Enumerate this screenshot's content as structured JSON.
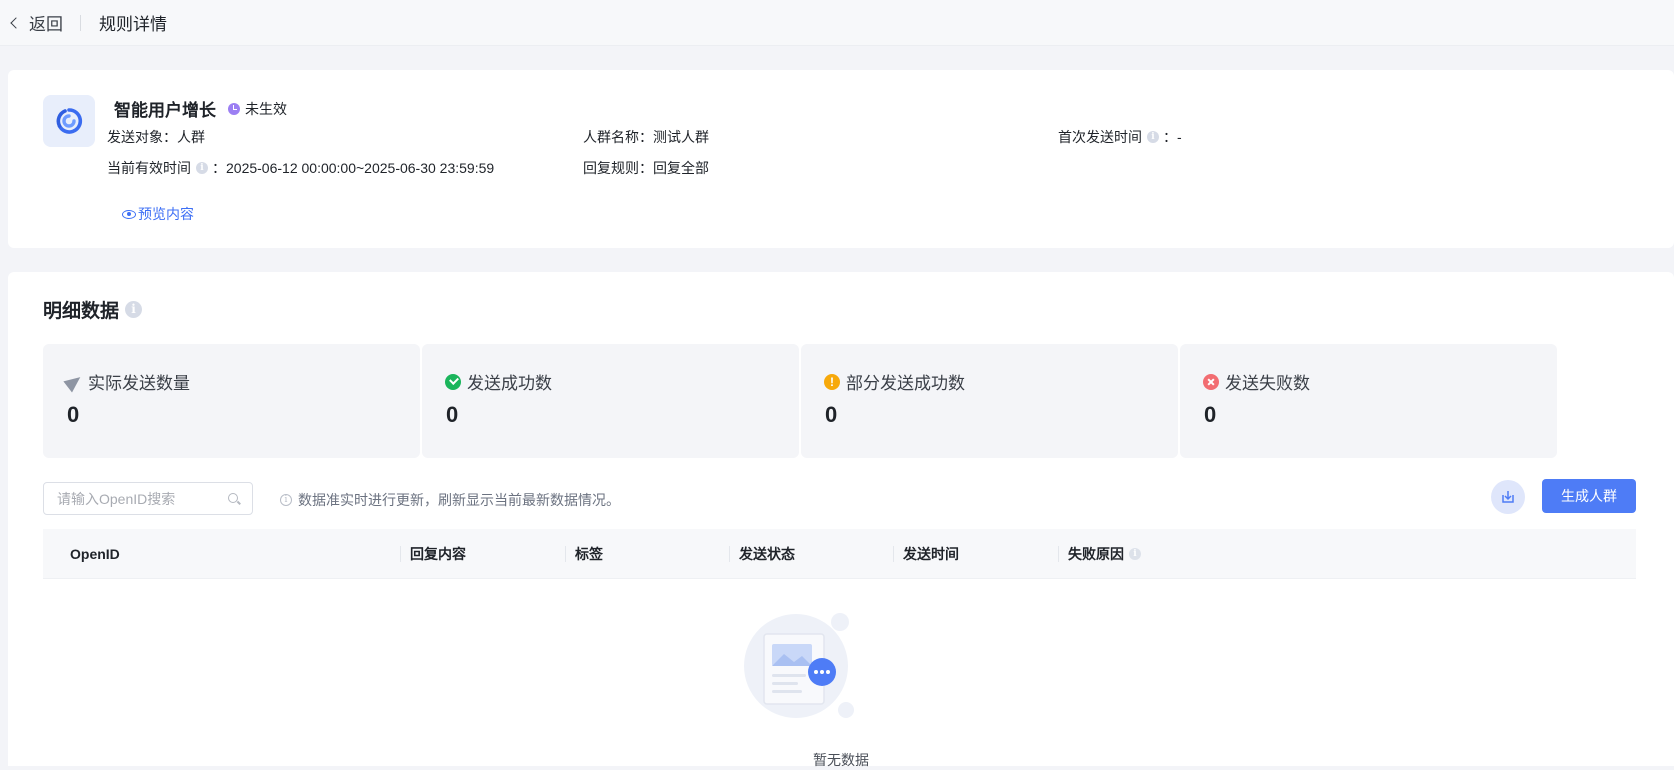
{
  "topbar": {
    "back_label": "返回",
    "page_title": "规则详情"
  },
  "rule": {
    "name": "智能用户增长",
    "status": "未生效",
    "fields": {
      "send_target_label": "发送对象：",
      "send_target_value": "人群",
      "crowd_name_label": "人群名称：",
      "crowd_name_value": "测试人群",
      "first_send_label": "首次发送时间",
      "first_send_value": "：-",
      "valid_time_label": "当前有效时间",
      "valid_time_value": "：2025-06-12 00:00:00~2025-06-30 23:59:59",
      "reply_rule_label": "回复规则：",
      "reply_rule_value": "回复全部"
    },
    "preview_label": "预览内容"
  },
  "detail": {
    "title": "明细数据",
    "stats": [
      {
        "label": "实际发送数量",
        "value": "0",
        "icon": "send-plane-icon"
      },
      {
        "label": "发送成功数",
        "value": "0",
        "icon": "success-check-icon"
      },
      {
        "label": "部分发送成功数",
        "value": "0",
        "icon": "warning-icon"
      },
      {
        "label": "发送失败数",
        "value": "0",
        "icon": "fail-x-icon"
      }
    ],
    "search_placeholder": "请输入OpenID搜索",
    "tip": "数据准实时进行更新，刷新显示当前最新数据情况。",
    "generate_button": "生成人群",
    "columns": [
      "OpenID",
      "回复内容",
      "标签",
      "发送状态",
      "发送时间",
      "失败原因"
    ],
    "rows": [],
    "empty_text": "暂无数据"
  },
  "colors": {
    "primary": "#4e7cf6",
    "success": "#1bb55c",
    "warning": "#f7a90b",
    "danger": "#f26d72",
    "status_pending": "#9c7ff3"
  }
}
